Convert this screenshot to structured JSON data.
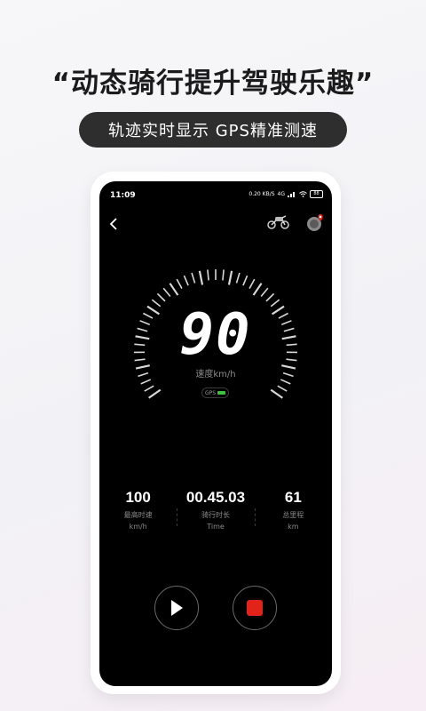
{
  "promo": {
    "headline": "“动态骑行提升驾驶乐趣”",
    "subtitle": "轨迹实时显示 GPS精准测速"
  },
  "status_bar": {
    "time": "11:09",
    "network_speed": "0.20 KB/S",
    "network_type": "4G",
    "battery": "88"
  },
  "nav": {
    "back_icon": "chevron-left-icon",
    "motorcycle_icon": "motorcycle-icon",
    "location_icon": "location-pin-icon"
  },
  "speedometer": {
    "speed": "90",
    "unit_label": "速度km/h",
    "gps_label": "GPS",
    "gps_signal_color": "#3cc23c"
  },
  "stats": [
    {
      "value": "100",
      "label": "最高时速",
      "unit": "km/h"
    },
    {
      "value": "00.45.03",
      "label": "骑行时长",
      "unit": "Time"
    },
    {
      "value": "61",
      "label": "总里程",
      "unit": "km"
    }
  ],
  "controls": {
    "play_icon": "play-icon",
    "stop_icon": "stop-icon",
    "stop_color": "#e2231a"
  }
}
